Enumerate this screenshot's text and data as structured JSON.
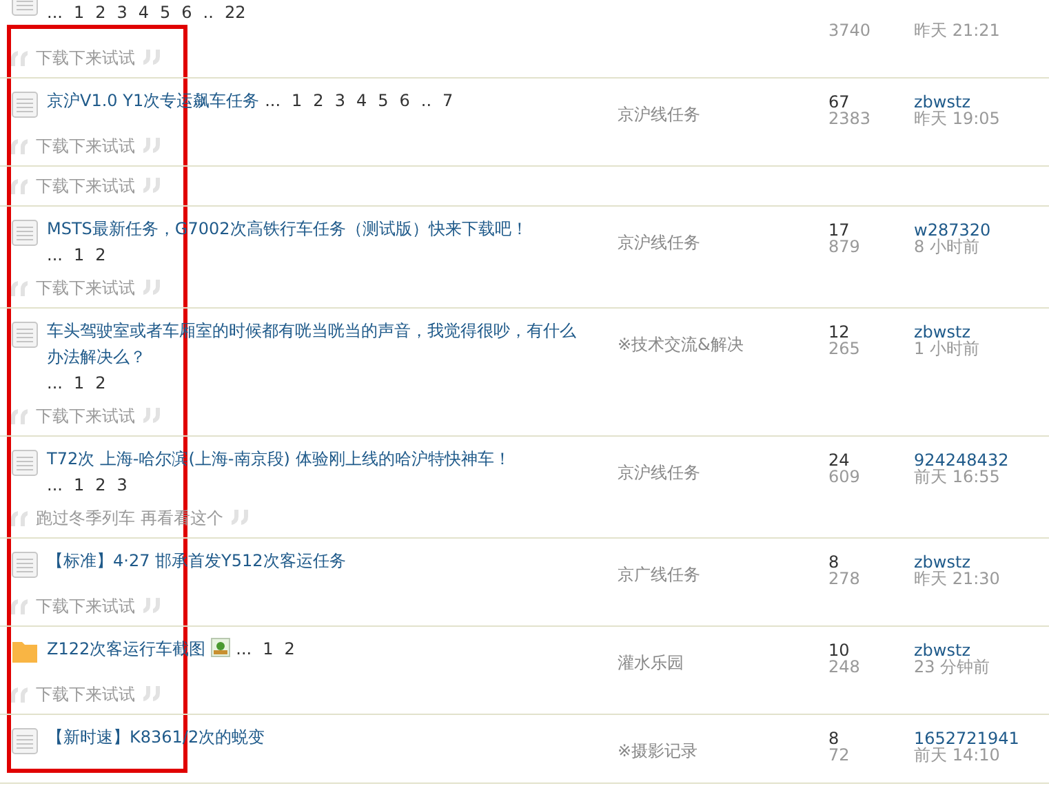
{
  "threads": [
    {
      "kind": "document",
      "pages": [
        "...",
        "1",
        "2",
        "3",
        "4",
        "5",
        "6",
        "..",
        "22"
      ],
      "views": "3740",
      "time": "昨天 21:21",
      "quote": "下载下来试试"
    },
    {
      "kind": "document",
      "title": "京沪V1.0 Y1次专运飙车任务",
      "pages": [
        "...",
        "1",
        "2",
        "3",
        "4",
        "5",
        "6",
        "..",
        "7"
      ],
      "forum": "京沪线任务",
      "replies": "67",
      "views": "2383",
      "author": "zbwstz",
      "time": "昨天 19:05",
      "quote": "下载下来试试"
    },
    {
      "quote": "下载下来试试"
    },
    {
      "kind": "document",
      "title": "MSTS最新任务，G7002次高铁行车任务（测试版）快来下载吧！",
      "pages": [
        "...",
        "1",
        "2"
      ],
      "forum": "京沪线任务",
      "replies": "17",
      "views": "879",
      "author": "w287320",
      "time": "8 小时前",
      "quote": "下载下来试试"
    },
    {
      "kind": "document",
      "title": "车头驾驶室或者车厢室的时候都有咣当咣当的声音，我觉得很吵，有什么办法解决么？",
      "pages": [
        "...",
        "1",
        "2"
      ],
      "forum": "※技术交流&解决",
      "replies": "12",
      "views": "265",
      "author": "zbwstz",
      "time": "1 小时前",
      "quote": "下载下来试试"
    },
    {
      "kind": "document",
      "title": "T72次 上海-哈尔滨(上海-南京段) 体验刚上线的哈沪特快神车！",
      "pages": [
        "...",
        "1",
        "2",
        "3"
      ],
      "forum": "京沪线任务",
      "replies": "24",
      "views": "609",
      "author": "924248432",
      "time": "前天 16:55",
      "quote": "跑过冬季列车 再看看这个"
    },
    {
      "kind": "document",
      "title": "【标准】4·27 邯承首发Y512次客运任务",
      "forum": "京广线任务",
      "replies": "8",
      "views": "278",
      "author": "zbwstz",
      "time": "昨天 21:30",
      "quote": "下载下来试试"
    },
    {
      "kind": "folder",
      "title": "Z122次客运行车截图",
      "has_image": true,
      "pages": [
        "...",
        "1",
        "2"
      ],
      "forum": "灌水乐园",
      "replies": "10",
      "views": "248",
      "author": "zbwstz",
      "time": "23 分钟前",
      "quote": "下载下来试试"
    },
    {
      "kind": "document",
      "title": "【新时速】K8361/2次的蜕变",
      "forum": "※摄影记录",
      "replies": "8",
      "views": "72",
      "author": "1652721941",
      "time": "前天 14:10"
    }
  ]
}
